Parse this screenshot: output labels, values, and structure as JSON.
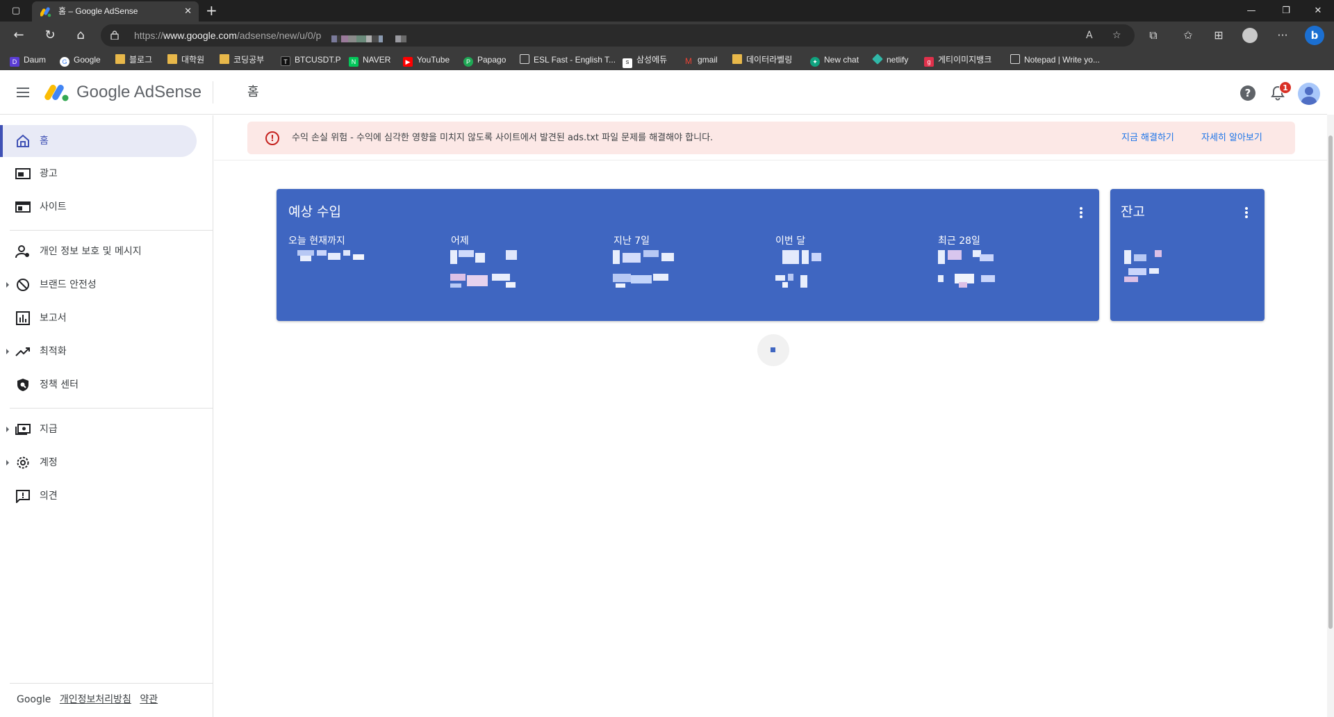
{
  "browser": {
    "tab_title": "홈 – Google AdSense",
    "url_prefix": "https://",
    "url_host": "www.google.com",
    "url_path": "/adsense/new/u/0/p",
    "bookmarks": [
      "Daum",
      "Google",
      "블로그",
      "대학원",
      "코딩공부",
      "BTCUSDT.P",
      "NAVER",
      "YouTube",
      "Papago",
      "ESL Fast - English T...",
      "삼성에듀",
      "gmail",
      "데이터라벨링",
      "New chat",
      "netlify",
      "게티이미지뱅크",
      "Notepad | Write yo..."
    ]
  },
  "header": {
    "brand": "Google AdSense",
    "page_title": "홈",
    "help_glyph": "?",
    "notification_count": "1"
  },
  "sidebar": {
    "items": [
      {
        "label": "홈",
        "icon": "home-icon"
      },
      {
        "label": "광고",
        "icon": "ads-icon"
      },
      {
        "label": "사이트",
        "icon": "sites-icon"
      },
      {
        "label": "개인 정보 보호 및 메시지",
        "icon": "privacy-icon"
      },
      {
        "label": "브랜드 안전성",
        "icon": "block-icon"
      },
      {
        "label": "보고서",
        "icon": "reports-icon"
      },
      {
        "label": "최적화",
        "icon": "trending-icon"
      },
      {
        "label": "정책 센터",
        "icon": "policy-icon"
      },
      {
        "label": "지급",
        "icon": "payments-icon"
      },
      {
        "label": "계정",
        "icon": "gear-icon"
      },
      {
        "label": "의견",
        "icon": "feedback-icon"
      }
    ],
    "footer": {
      "google": "Google",
      "privacy": "개인정보처리방침",
      "terms": "약관"
    }
  },
  "banner": {
    "text": "수익 손실 위험 - 수익에 심각한 영향을 미치지 않도록 사이트에서 발견된 ads.txt 파일 문제를 해결해야 합니다.",
    "fix_link": "지금 해결하기",
    "learn_link": "자세히 알아보기"
  },
  "earnings_card": {
    "title": "예상 수입",
    "metrics": [
      "오늘 현재까지",
      "어제",
      "지난 7일",
      "이번 달",
      "최근 28일"
    ]
  },
  "balance_card": {
    "title": "잔고"
  },
  "colors": {
    "accent": "#3f51b5",
    "card": "#3f66c1",
    "warning": "#c5221f"
  }
}
